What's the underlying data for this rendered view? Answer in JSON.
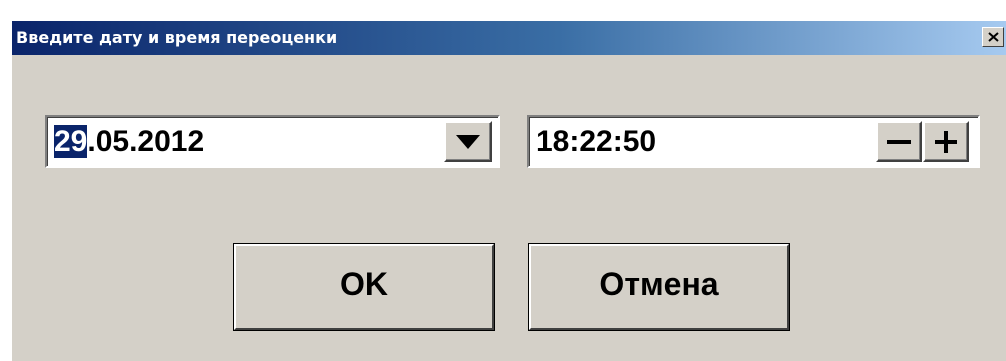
{
  "dialog": {
    "title": "Введите дату и время переоценки"
  },
  "date_field": {
    "day": "29",
    "rest": ".05.2012"
  },
  "time_field": {
    "value": "18:22:50"
  },
  "buttons": {
    "ok_label": "OK",
    "cancel_label": "Отмена"
  },
  "icons": {
    "close": "close-icon",
    "dropdown": "triangle-down-icon",
    "minus": "minus-icon",
    "plus": "plus-icon"
  }
}
